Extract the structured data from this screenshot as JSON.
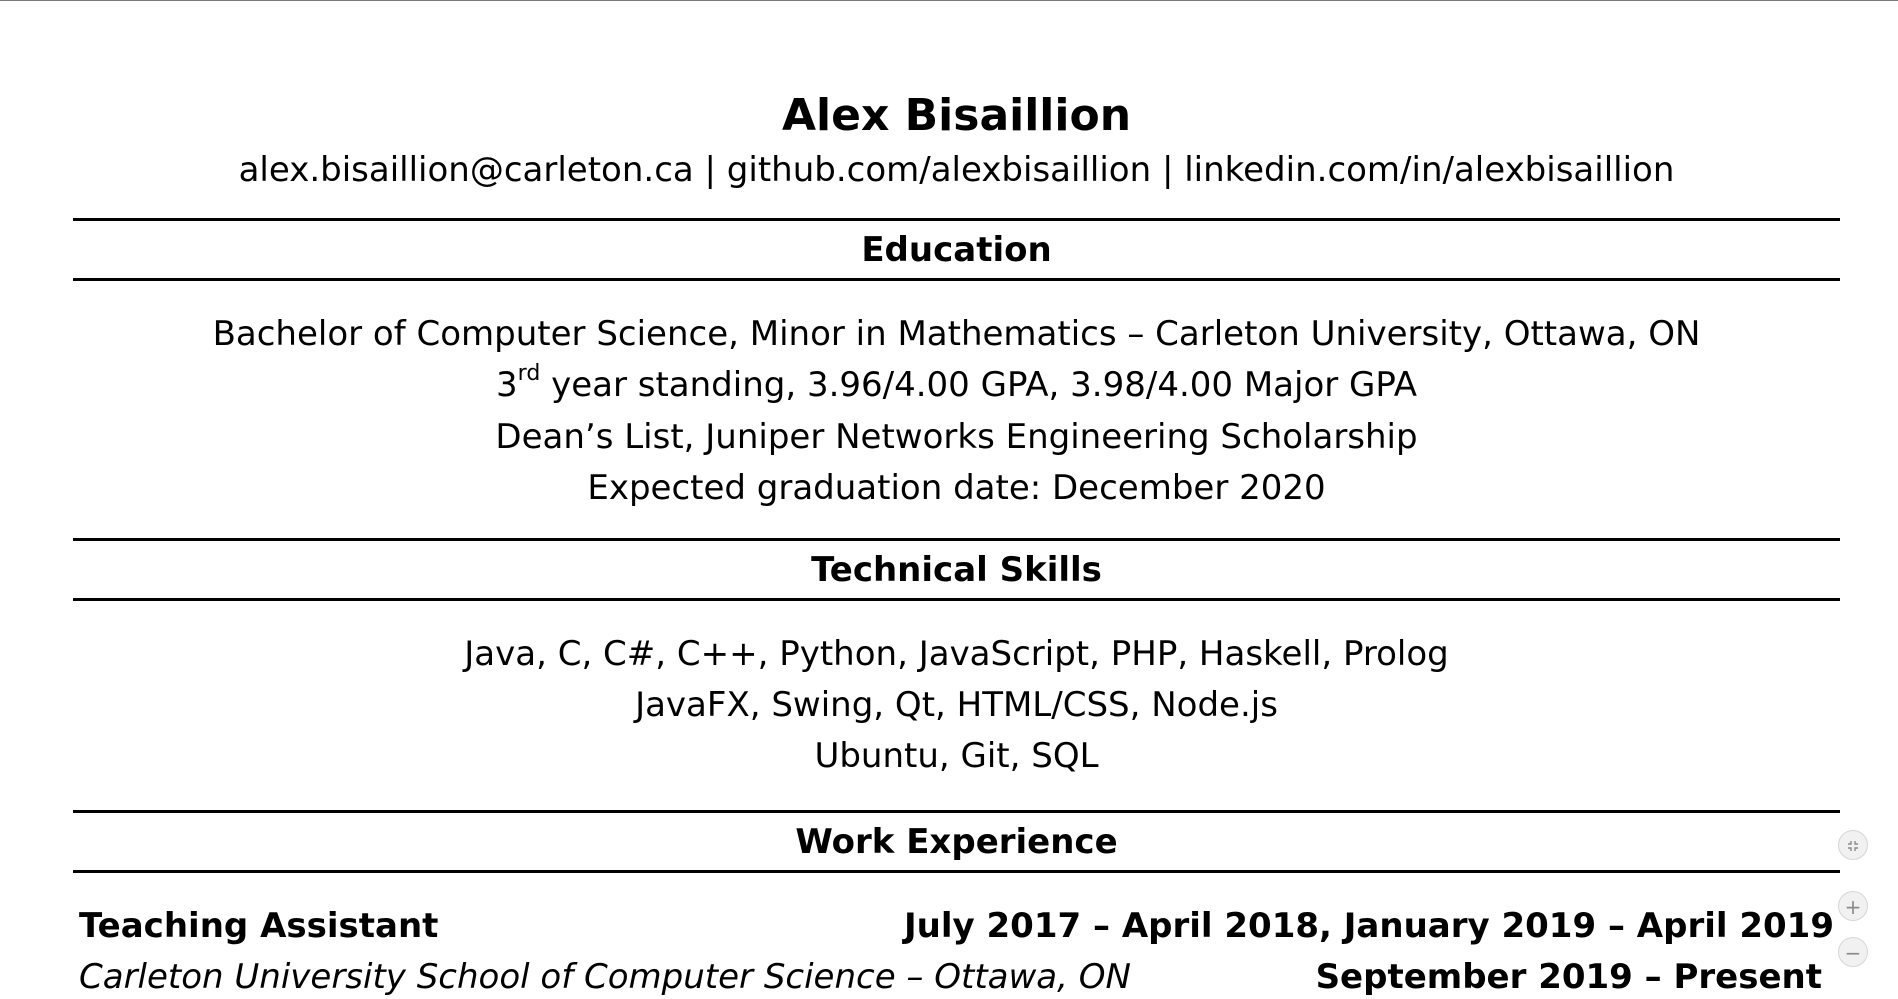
{
  "header": {
    "name": "Alex Bisaillion",
    "contact": "alex.bisaillion@carleton.ca | github.com/alexbisaillion | linkedin.com/in/alexbisaillion"
  },
  "education": {
    "title": "Education",
    "degree": "Bachelor of Computer Science, Minor in Mathematics – Carleton University, Ottawa, ON",
    "standing_prefix": "3",
    "standing_sup": "rd",
    "standing_rest": " year standing, 3.96/4.00 GPA, 3.98/4.00 Major GPA",
    "awards": "Dean’s List, Juniper Networks Engineering Scholarship",
    "graduation": "Expected graduation date: December 2020"
  },
  "skills": {
    "title": "Technical Skills",
    "lines": [
      "Java, C, C#, C++, Python, JavaScript, PHP, Haskell, Prolog",
      "JavaFX, Swing, Qt, HTML/CSS, Node.js",
      "Ubuntu, Git, SQL"
    ]
  },
  "work": {
    "title": "Work Experience",
    "job": {
      "role": "Teaching Assistant",
      "dates_primary": "July 2017 – April 2018, January 2019 – April 2019",
      "employer": "Carleton University School of Computer Science – Ottawa, ON",
      "dates_secondary": "September 2019 – Present"
    }
  },
  "viewer_controls": {
    "fit_icon": "fit-page-icon",
    "zoom_in_symbol": "+",
    "zoom_out_symbol": "−"
  }
}
